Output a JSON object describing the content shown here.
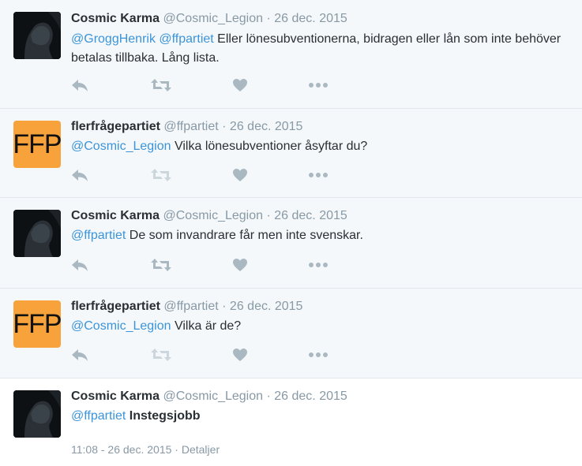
{
  "tweets": [
    {
      "name": "Cosmic Karma",
      "handle": "@Cosmic_Legion",
      "separator": "·",
      "date": "26 dec. 2015",
      "mentions": [
        "@GroggHenrik",
        "@ffpartiet"
      ],
      "text": "Eller lönesubventionerna, bidragen eller lån som inte behöver betalas tillbaka. Lång lista."
    },
    {
      "name": "flerfrågepartiet",
      "handle": "@ffpartiet",
      "separator": "·",
      "date": "26 dec. 2015",
      "avatar_text": "FFP",
      "mentions": [
        "@Cosmic_Legion"
      ],
      "text": "Vilka lönesubventioner åsyftar du?"
    },
    {
      "name": "Cosmic Karma",
      "handle": "@Cosmic_Legion",
      "separator": "·",
      "date": "26 dec. 2015",
      "mentions": [
        "@ffpartiet"
      ],
      "text": "De som invandrare får men inte svenskar."
    },
    {
      "name": "flerfrågepartiet",
      "handle": "@ffpartiet",
      "separator": "·",
      "date": "26 dec. 2015",
      "avatar_text": "FFP",
      "mentions": [
        "@Cosmic_Legion"
      ],
      "text": "Vilka är de?"
    },
    {
      "name": "Cosmic Karma",
      "handle": "@Cosmic_Legion",
      "separator": "·",
      "date": "26 dec. 2015",
      "mentions": [
        "@ffpartiet"
      ],
      "text": "Instegsjobb",
      "timestamp": "11:08 - 26 dec. 2015",
      "details_separator": "·",
      "details_label": "Detaljer"
    }
  ],
  "icons": [
    "reply-icon",
    "retweet-icon",
    "like-icon",
    "more-icon"
  ],
  "colors": {
    "link": "#3b94d9",
    "muted": "#8899a6",
    "icon": "#aab8c2",
    "icon_disabled": "#ccd6dd",
    "ffp_avatar": "#f7a23b"
  }
}
